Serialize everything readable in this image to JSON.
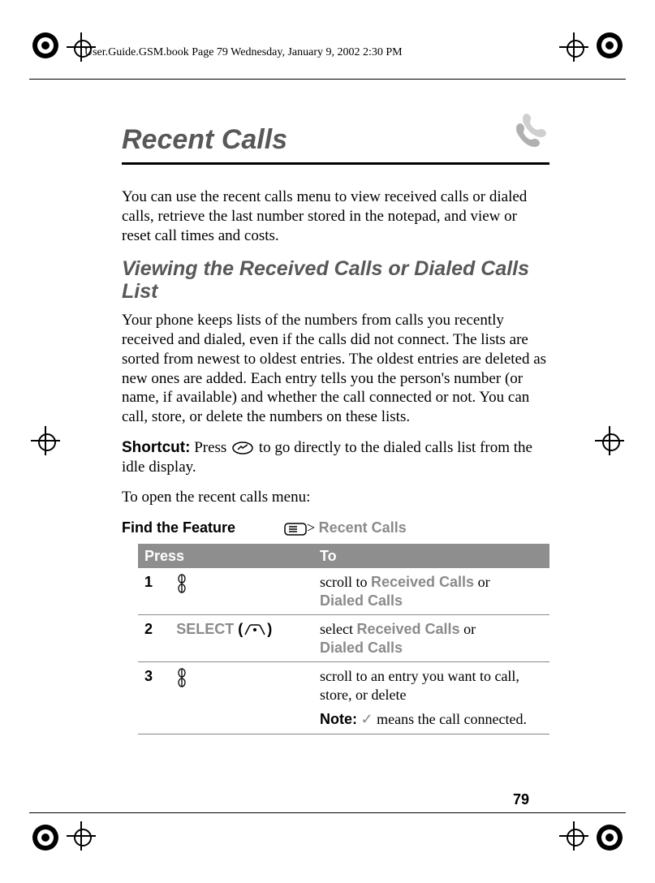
{
  "header": "User.Guide.GSM.book  Page 79  Wednesday, January 9, 2002  2:30 PM",
  "title": "Recent Calls",
  "intro": "You can use the recent calls menu to view received calls or dialed calls, retrieve the last number stored in the notepad, and view or reset call times and costs.",
  "section_heading": "Viewing the Received Calls or Dialed Calls List",
  "section_body": "Your phone keeps lists of the numbers from calls you recently received and dialed, even if the calls did not connect. The lists are sorted from newest to oldest entries. The oldest entries are deleted as new ones are added. Each entry tells you the person's number (or name, if available) and whether the call connected or not. You can call, store, or delete the numbers on these lists.",
  "shortcut_label": "Shortcut:",
  "shortcut_before_icon": " Press ",
  "shortcut_after_icon": " to go directly to the dialed calls list from the idle display.",
  "open_line": "To open the recent calls menu:",
  "feature": {
    "label": "Find the Feature",
    "sep": "> ",
    "menu_name": "Recent Calls"
  },
  "table": {
    "head": {
      "press": "Press",
      "to": "To"
    },
    "rows": [
      {
        "num": "1",
        "key_text": "",
        "key_icon": "scroll",
        "to_before": "scroll to ",
        "to_ui1": "Received Calls",
        "to_mid": " or ",
        "to_ui2": "Dialed Calls"
      },
      {
        "num": "2",
        "key_text": "SELECT",
        "key_paren_icon": "softkey",
        "to_before": "select ",
        "to_ui1": "Received Calls",
        "to_mid": " or ",
        "to_ui2": "Dialed Calls"
      },
      {
        "num": "3",
        "key_text": "",
        "key_icon": "scroll",
        "to_plain": "scroll to an entry you want to call, store, or delete",
        "note_label": "Note:",
        "note_after_icon": " means the call connected."
      }
    ]
  },
  "page_number": "79",
  "icons": {
    "scroll": "scroll-key-icon",
    "softkey": "softkey-icon",
    "menu": "menu-key-icon",
    "send": "send-key-icon",
    "phone": "phone-section-icon",
    "check": "checkmark-icon"
  }
}
